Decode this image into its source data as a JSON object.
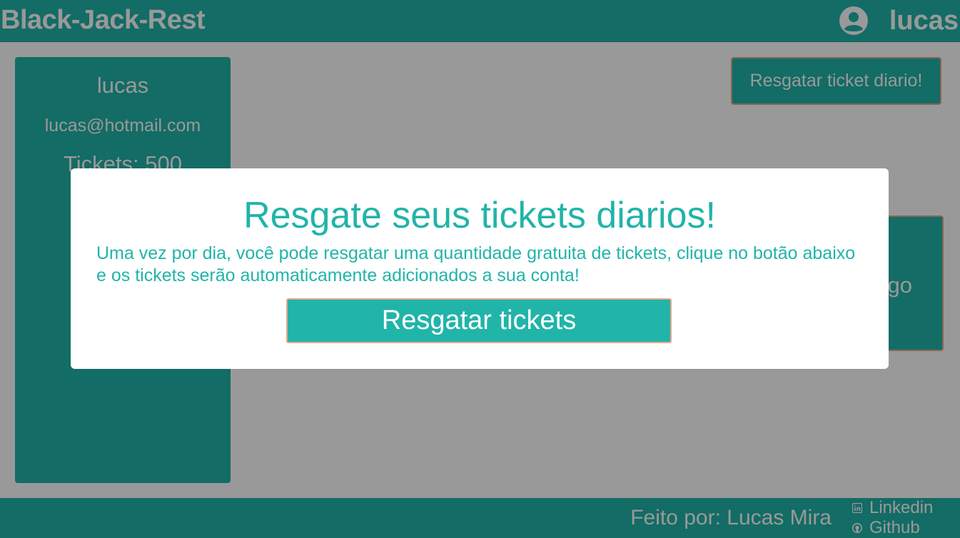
{
  "colors": {
    "accent": "#21b4a9",
    "button_border": "#e3a98c",
    "overlay": "rgba(0,0,0,0.4)",
    "modal_bg": "#ffffff"
  },
  "header": {
    "brand": "Black-Jack-Rest",
    "user_icon": "user-circle-icon",
    "username": "lucas"
  },
  "profile": {
    "name": "lucas",
    "email": "lucas@hotmail.com",
    "tickets": "Tickets: 500"
  },
  "actions": {
    "daily_ticket_button": "Resgatar ticket diario!"
  },
  "game_card": {
    "visible_label": "go"
  },
  "modal": {
    "title": "Resgate seus tickets diarios!",
    "body": "Uma vez por dia, você pode resgatar uma quantidade gratuita de tickets, clique no botão abaixo e os tickets serão automaticamente adicionados a sua conta!",
    "button": "Resgatar tickets"
  },
  "footer": {
    "credit": "Feito por: Lucas Mira",
    "links": [
      {
        "label": "Linkedin",
        "icon": "linkedin-icon"
      },
      {
        "label": "Github",
        "icon": "github-icon"
      }
    ]
  }
}
